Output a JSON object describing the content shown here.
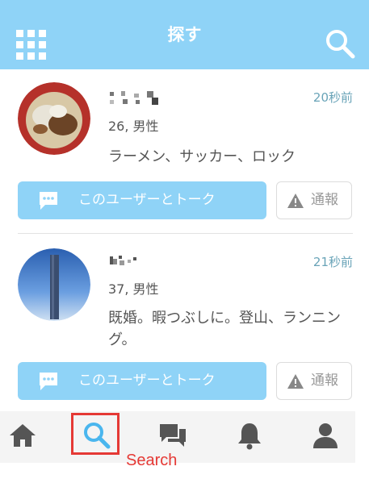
{
  "header": {
    "title": "探す",
    "menu_icon": "grid-icon",
    "search_icon": "search-icon",
    "background": "#8fd3f7"
  },
  "users": [
    {
      "name": "",
      "age_gender": "26, 男性",
      "time": "20秒前",
      "bio": "ラーメン、サッカー、ロック",
      "talk_label": "このユーザーとトーク",
      "report_label": "通報"
    },
    {
      "name": "",
      "age_gender": "37, 男性",
      "time": "21秒前",
      "bio": "既婚。暇つぶしに。登山、ランニング。",
      "talk_label": "このユーザーとトーク",
      "report_label": "通報"
    }
  ],
  "tabbar": {
    "items": [
      {
        "icon": "home-icon"
      },
      {
        "icon": "search-icon",
        "active": true
      },
      {
        "icon": "chat-icon"
      },
      {
        "icon": "bell-icon"
      },
      {
        "icon": "user-icon"
      }
    ],
    "active_color": "#4ab6ee",
    "inactive_color": "#555555"
  },
  "annotation": {
    "caption": "Search",
    "color": "#e53935"
  }
}
